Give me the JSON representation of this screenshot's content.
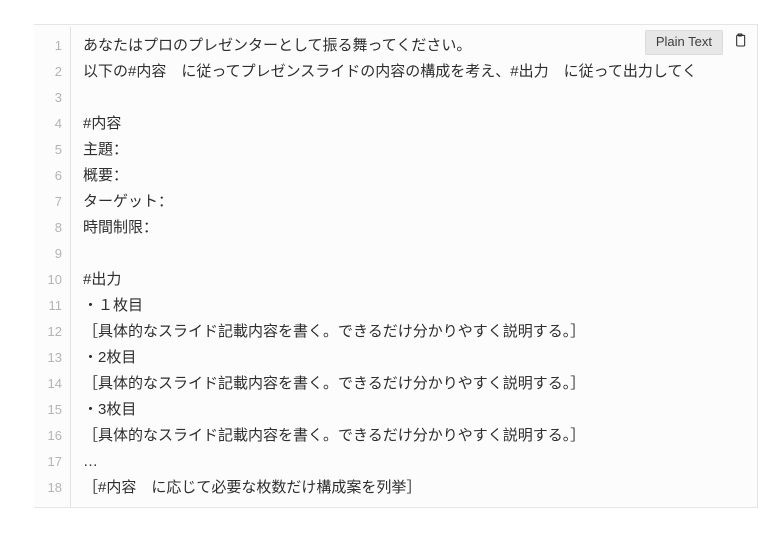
{
  "toolbar": {
    "language_label": "Plain Text"
  },
  "code": {
    "lines": [
      "あなたはプロのプレゼンターとして振る舞ってください。",
      "以下の#内容　に従ってプレゼンスライドの内容の構成を考え、#出力　に従って出力してく",
      "",
      "#内容",
      "主題：",
      "概要：",
      "ターゲット：",
      "時間制限：",
      "",
      "#出力",
      "・１枚目",
      "［具体的なスライド記載内容を書く。できるだけ分かりやすく説明する。］",
      "・2枚目",
      "［具体的なスライド記載内容を書く。できるだけ分かりやすく説明する。］",
      "・3枚目",
      "［具体的なスライド記載内容を書く。できるだけ分かりやすく説明する。］",
      "…",
      "［#内容　に応じて必要な枚数だけ構成案を列挙］"
    ]
  }
}
